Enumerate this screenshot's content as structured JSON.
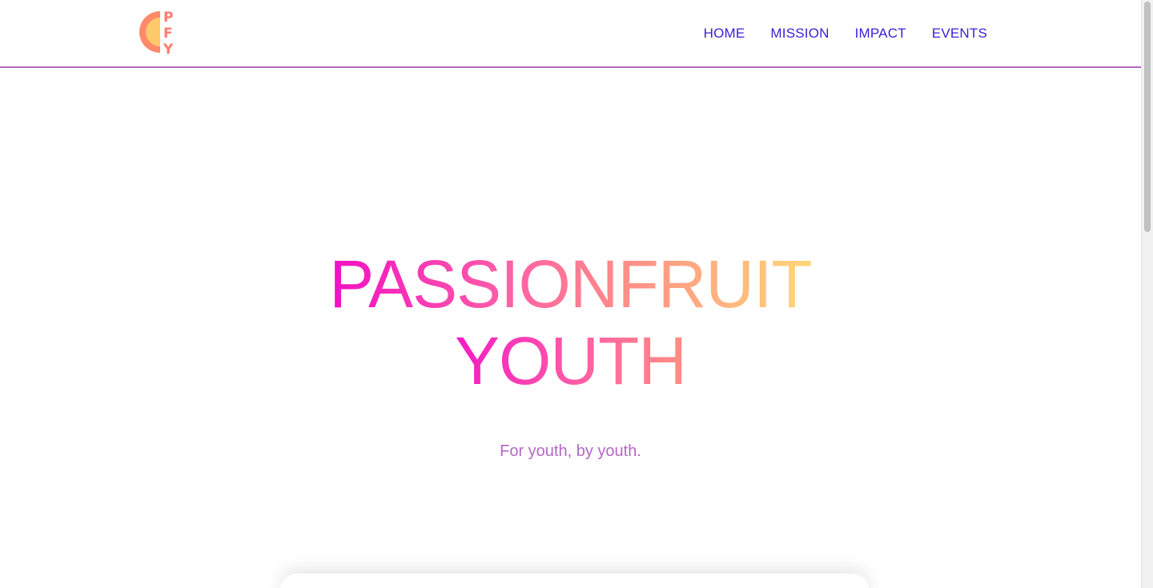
{
  "brand": {
    "logo_letters": [
      "P",
      "F",
      "Y"
    ],
    "colors": {
      "logo_outer": "#ff8a6a",
      "logo_inner": "#ffc96b",
      "logo_text": "#ff7a6e"
    }
  },
  "nav": {
    "items": [
      {
        "label": "HOME"
      },
      {
        "label": "MISSION"
      },
      {
        "label": "IMPACT"
      },
      {
        "label": "EVENTS"
      }
    ],
    "color": "#3a1fd6"
  },
  "header": {
    "divider_color": "#b06ac4"
  },
  "hero": {
    "title_line1": "PASSIONFRUIT",
    "title_line2": "YOUTH",
    "tagline": "For youth, by youth.",
    "tagline_color": "#b467c6",
    "gradient_colors": [
      "#f10fc4",
      "#ff5ca8",
      "#ff8f86",
      "#ffd77a"
    ]
  }
}
